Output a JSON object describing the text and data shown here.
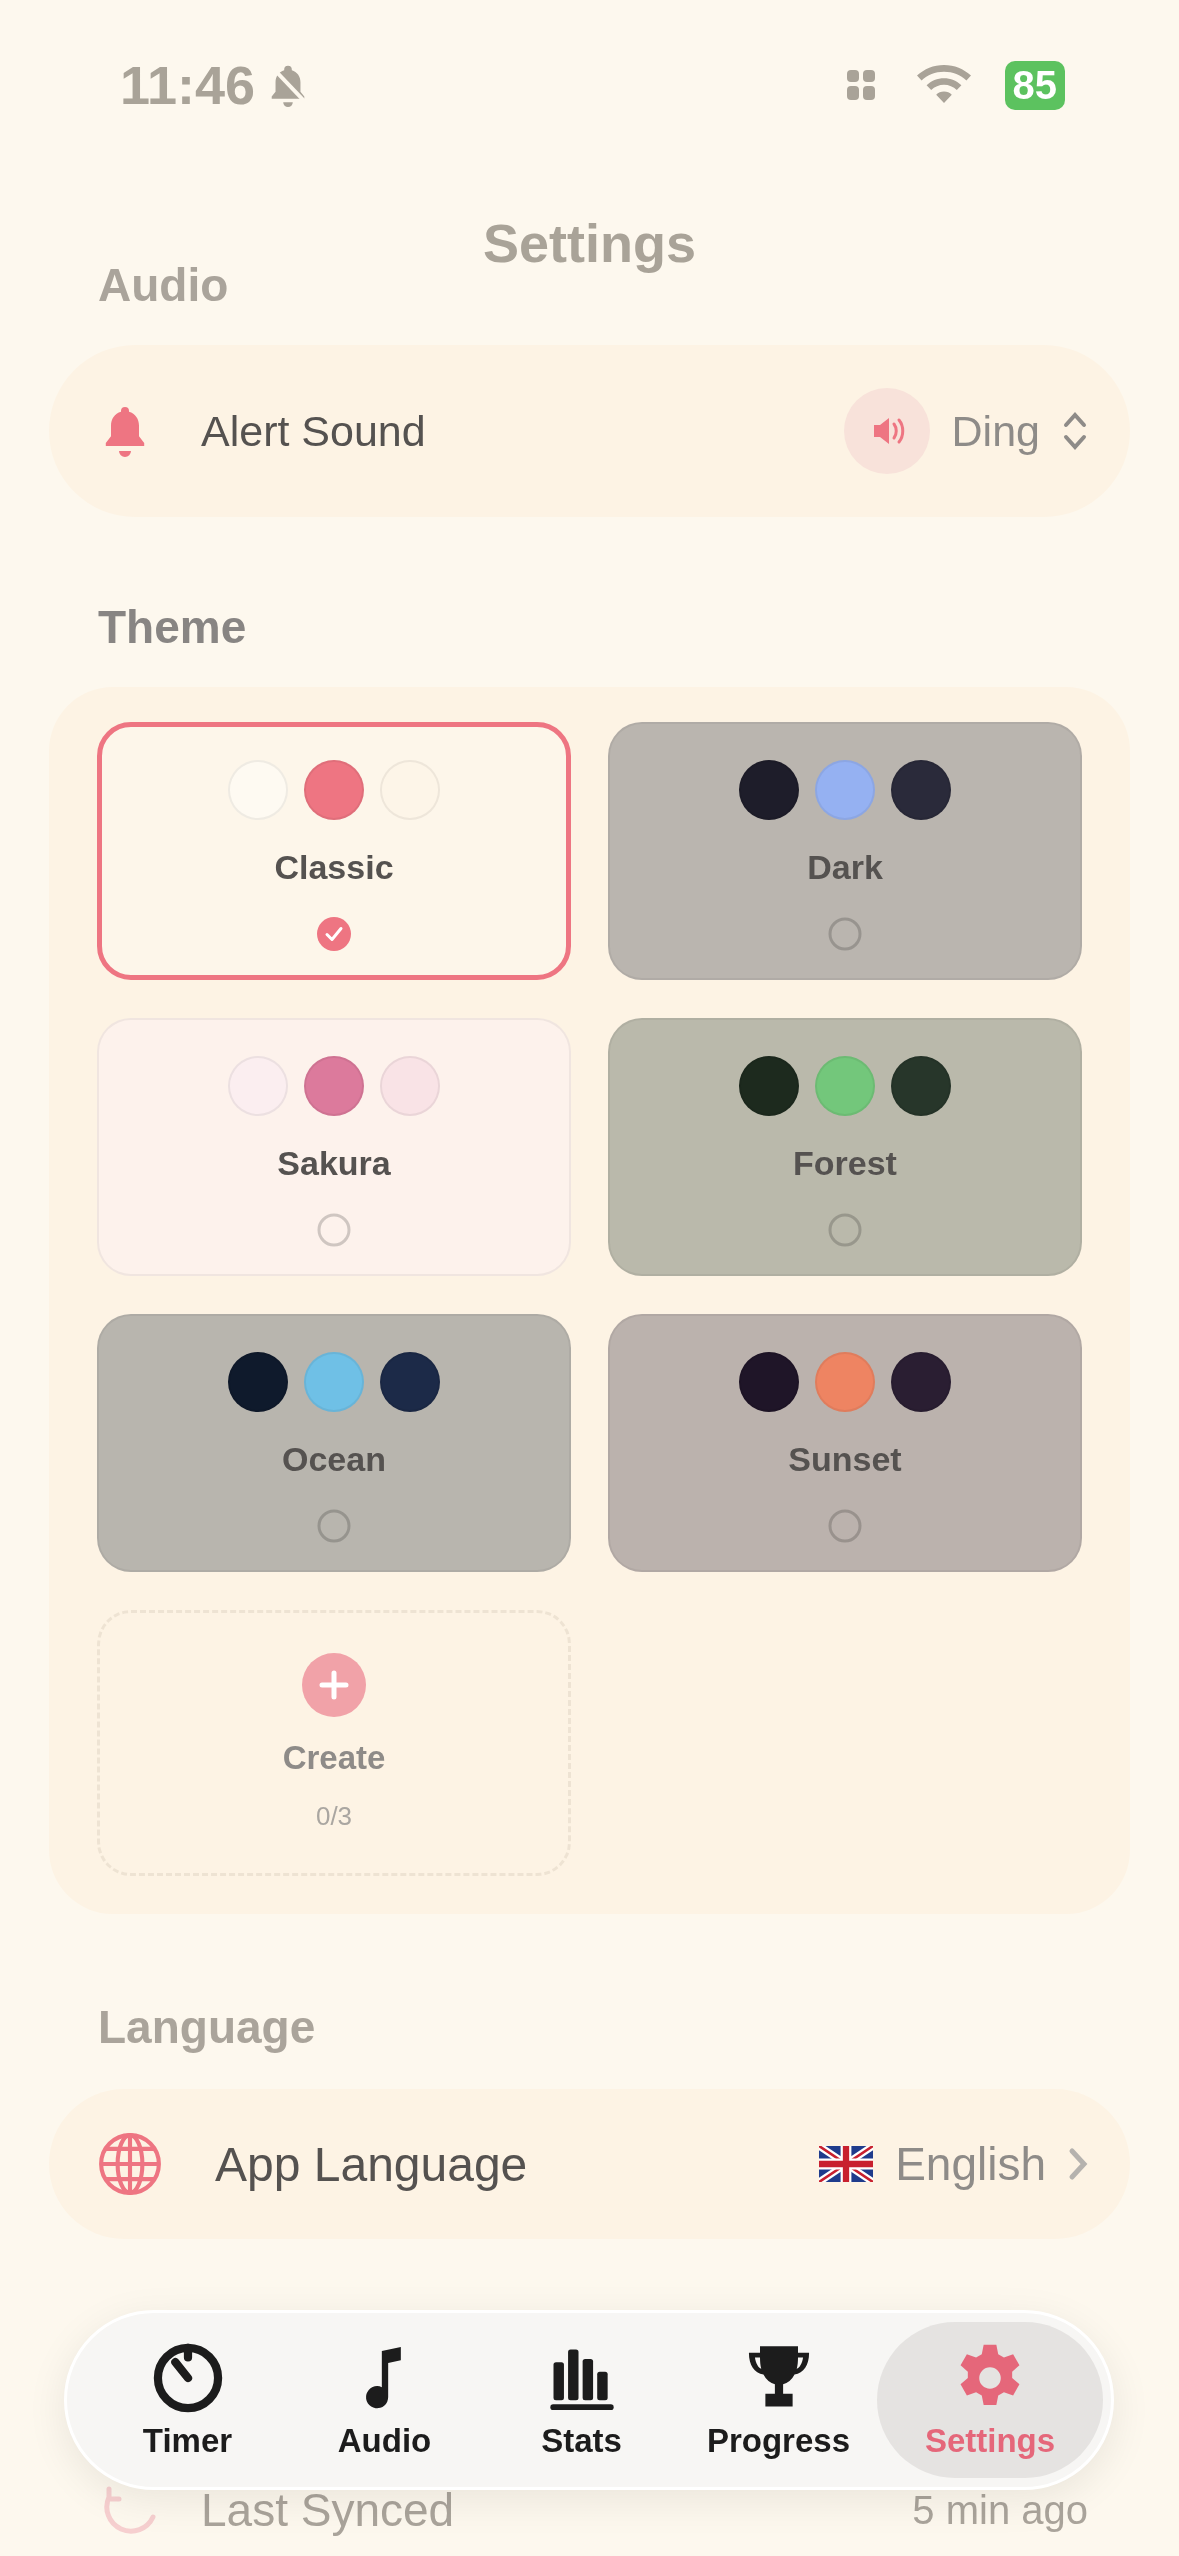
{
  "status_bar": {
    "time": "11:46",
    "battery": "85"
  },
  "title": "Settings",
  "sections": [
    {
      "heading": "Audio",
      "rows": [
        {
          "kind": "picker",
          "label": "Alert Sound",
          "value": "Ding"
        }
      ]
    },
    {
      "heading": "Theme",
      "themes": [
        {
          "name": "Classic",
          "selected": true,
          "color": "#fdf6ea",
          "swatches": [
            {
              "color": "#fefaf2"
            },
            {
              "color": "#ee7582"
            },
            {
              "color": "#fdf5e8"
            }
          ]
        },
        {
          "name": "Dark",
          "selected": false,
          "color": "#bab5af",
          "swatches": [
            {
              "color": "#1e1d2a"
            },
            {
              "color": "#95b1f2"
            },
            {
              "color": "#2a2a3a"
            }
          ]
        },
        {
          "name": "Sakura",
          "selected": false,
          "color": "#fdf2ec",
          "swatches": [
            {
              "color": "#fbeef0"
            },
            {
              "color": "#dc7a9c"
            },
            {
              "color": "#f9e3e6"
            }
          ]
        },
        {
          "name": "Forest",
          "selected": false,
          "color": "#bab9ab",
          "swatches": [
            {
              "color": "#1d2a1e"
            },
            {
              "color": "#73c77b"
            },
            {
              "color": "#27362a"
            }
          ]
        },
        {
          "name": "Ocean",
          "selected": false,
          "color": "#b8b5ae",
          "swatches": [
            {
              "color": "#0f1a2c"
            },
            {
              "color": "#6fc0e6"
            },
            {
              "color": "#1c2a48"
            }
          ]
        },
        {
          "name": "Sunset",
          "selected": false,
          "color": "#bbb2ad",
          "swatches": [
            {
              "color": "#1f1528"
            },
            {
              "color": "#ee8462"
            },
            {
              "color": "#2a1e32"
            }
          ]
        }
      ],
      "create": {
        "label": "Create",
        "count": "0/3"
      }
    },
    {
      "heading": "Language",
      "rows": [
        {
          "kind": "link",
          "label": "App Language",
          "value": "English"
        }
      ]
    }
  ],
  "sync": {
    "label": "Last Synced",
    "value": "5 min ago"
  },
  "tabs": [
    {
      "label": "Timer",
      "selected": false
    },
    {
      "label": "Audio",
      "selected": false
    },
    {
      "label": "Stats",
      "selected": false
    },
    {
      "label": "Progress",
      "selected": false
    },
    {
      "label": "Settings",
      "selected": true
    }
  ]
}
